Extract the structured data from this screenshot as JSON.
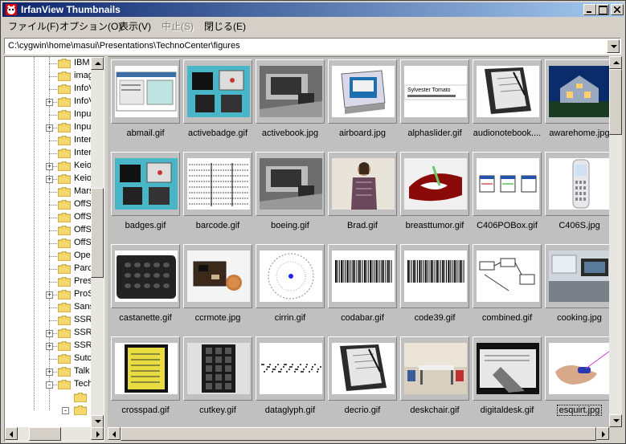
{
  "window": {
    "title": "IrfanView Thumbnails"
  },
  "menu": [
    {
      "label": "ファイル(F)",
      "disabled": false
    },
    {
      "label": "オプション(O)",
      "disabled": false
    },
    {
      "label": "表示(V)",
      "disabled": false
    },
    {
      "label": "中止(S)",
      "disabled": true
    },
    {
      "label": "閉じる(E)",
      "disabled": false
    }
  ],
  "path": "C:\\cygwin\\home\\masui\\Presentations\\TechnoCenter\\figures",
  "tree": [
    {
      "label": "IBM",
      "expander": ""
    },
    {
      "label": "imag",
      "expander": ""
    },
    {
      "label": "InfoV",
      "expander": ""
    },
    {
      "label": "InfoV",
      "expander": "+"
    },
    {
      "label": "Inpu",
      "expander": ""
    },
    {
      "label": "Inpu",
      "expander": "+"
    },
    {
      "label": "Inter",
      "expander": ""
    },
    {
      "label": "Inter",
      "expander": ""
    },
    {
      "label": "Keio",
      "expander": "+"
    },
    {
      "label": "Keio",
      "expander": "+"
    },
    {
      "label": "Mars",
      "expander": ""
    },
    {
      "label": "OffS",
      "expander": ""
    },
    {
      "label": "OffS",
      "expander": ""
    },
    {
      "label": "OffS",
      "expander": ""
    },
    {
      "label": "OffS",
      "expander": ""
    },
    {
      "label": "Oper",
      "expander": ""
    },
    {
      "label": "Parc",
      "expander": ""
    },
    {
      "label": "Pres",
      "expander": ""
    },
    {
      "label": "ProS",
      "expander": "+"
    },
    {
      "label": "Sans",
      "expander": ""
    },
    {
      "label": "SSR",
      "expander": ""
    },
    {
      "label": "SSR",
      "expander": "+"
    },
    {
      "label": "SSR",
      "expander": "+"
    },
    {
      "label": "Sutc",
      "expander": ""
    },
    {
      "label": "Talk",
      "expander": "+"
    },
    {
      "label": "Tech",
      "expander": "-"
    }
  ],
  "thumbnails": [
    {
      "name": "abmail.gif",
      "icon": "screenshot"
    },
    {
      "name": "activebadge.gif",
      "icon": "devices"
    },
    {
      "name": "activebook.jpg",
      "icon": "photo"
    },
    {
      "name": "airboard.jpg",
      "icon": "tablet"
    },
    {
      "name": "alphaslider.gif",
      "icon": "text"
    },
    {
      "name": "audionotebook....",
      "icon": "notebook"
    },
    {
      "name": "awarehome.jpg",
      "icon": "house"
    },
    {
      "name": "badges.gif",
      "icon": "devices"
    },
    {
      "name": "barcode.gif",
      "icon": "table"
    },
    {
      "name": "boeing.gif",
      "icon": "photo"
    },
    {
      "name": "Brad.gif",
      "icon": "person"
    },
    {
      "name": "breasttumor.gif",
      "icon": "medical"
    },
    {
      "name": "C406POBox.gif",
      "icon": "screens"
    },
    {
      "name": "C406S.jpg",
      "icon": "phone"
    },
    {
      "name": "castanette.gif",
      "icon": "keypad"
    },
    {
      "name": "ccrmote.jpg",
      "icon": "circuit"
    },
    {
      "name": "cirrin.gif",
      "icon": "circle"
    },
    {
      "name": "codabar.gif",
      "icon": "barcode"
    },
    {
      "name": "code39.gif",
      "icon": "barcode"
    },
    {
      "name": "combined.gif",
      "icon": "diagram"
    },
    {
      "name": "cooking.jpg",
      "icon": "kitchen"
    },
    {
      "name": "crosspad.gif",
      "icon": "pad"
    },
    {
      "name": "cutkey.gif",
      "icon": "keypad-tall"
    },
    {
      "name": "dataglyph.gif",
      "icon": "glyph"
    },
    {
      "name": "decrio.gif",
      "icon": "notebook"
    },
    {
      "name": "deskchair.gif",
      "icon": "room"
    },
    {
      "name": "digitaldesk.gif",
      "icon": "desk"
    },
    {
      "name": "esquirt.jpg",
      "icon": "hand",
      "selected": true
    }
  ]
}
